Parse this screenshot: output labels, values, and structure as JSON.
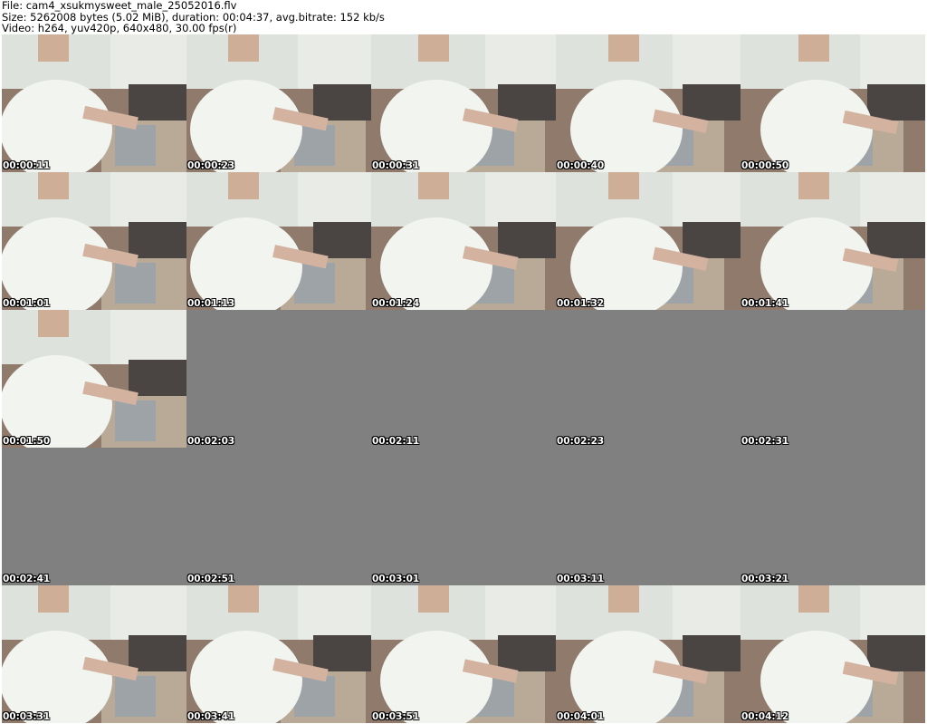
{
  "header": {
    "line1": "File: cam4_xsukmysweet_male_25052016.flv",
    "line2": "Size: 5262008 bytes (5.02 MiB), duration: 00:04:37, avg.bitrate: 152 kb/s",
    "line3": "Video: h264, yuv420p, 640x480, 30.00 fps(r)"
  },
  "thumbnails": [
    {
      "time": "00:00:11",
      "frame": true
    },
    {
      "time": "00:00:23",
      "frame": true
    },
    {
      "time": "00:00:31",
      "frame": true
    },
    {
      "time": "00:00:40",
      "frame": true
    },
    {
      "time": "00:00:50",
      "frame": true
    },
    {
      "time": "00:01:01",
      "frame": true
    },
    {
      "time": "00:01:13",
      "frame": true
    },
    {
      "time": "00:01:24",
      "frame": true
    },
    {
      "time": "00:01:32",
      "frame": true
    },
    {
      "time": "00:01:41",
      "frame": true
    },
    {
      "time": "00:01:50",
      "frame": true
    },
    {
      "time": "00:02:03",
      "frame": false
    },
    {
      "time": "00:02:11",
      "frame": false
    },
    {
      "time": "00:02:23",
      "frame": false
    },
    {
      "time": "00:02:31",
      "frame": false
    },
    {
      "time": "00:02:41",
      "frame": false
    },
    {
      "time": "00:02:51",
      "frame": false
    },
    {
      "time": "00:03:01",
      "frame": false
    },
    {
      "time": "00:03:11",
      "frame": false
    },
    {
      "time": "00:03:21",
      "frame": false
    },
    {
      "time": "00:03:31",
      "frame": true
    },
    {
      "time": "00:03:41",
      "frame": true
    },
    {
      "time": "00:03:51",
      "frame": true
    },
    {
      "time": "00:04:01",
      "frame": true
    },
    {
      "time": "00:04:12",
      "frame": true
    }
  ],
  "colors": {
    "background": "#ffffff",
    "empty_frame": "#808080",
    "timestamp_text": "#ffffff"
  }
}
